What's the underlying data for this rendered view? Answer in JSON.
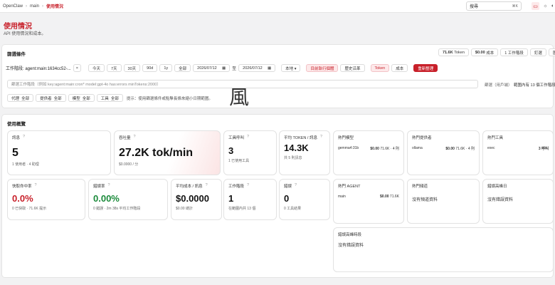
{
  "breadcrumb": {
    "root": "OpenClaw",
    "sep1": "›",
    "branch": "main",
    "sep2": "›",
    "current": "使用情況"
  },
  "search": {
    "value": "搜尋",
    "shortcut": "⌘K"
  },
  "page": {
    "title": "使用情況",
    "subtitle": "API 使用情況和成本。"
  },
  "filters": {
    "heading": "篩選條件",
    "tokens_value": "71.6K",
    "tokens_unit": "Token",
    "cost_value": "$0.00",
    "cost_unit": "成本",
    "sessions": "1 工作階段",
    "pin_label": "釘選",
    "export_label": "匯出 ▾",
    "session_label": "工作階段: agent:main:1634cc52-...",
    "clear": "×",
    "range_buttons": [
      "今天",
      "7天",
      "30天",
      "90d",
      "1y",
      "全部"
    ],
    "date_start": "2026/07/12",
    "to": "至",
    "date_end": "2026/07/12",
    "tz": "本地 ▾",
    "compare_current": "目前執行個體",
    "compare_history": "歷史沿革",
    "mode_token": "Token",
    "mode_cost": "成本",
    "refresh": "重新整理",
    "query_placeholder": "篩選工作階段（例如 key:agent:main:cron* model:gpt-4o has:errors minTokens:2000）",
    "query_hint": "篩選（用戶端）",
    "range_note": "範圍內有 13 個工作階段",
    "chips": [
      {
        "label": "代理",
        "value": "全部"
      },
      {
        "label": "提供者",
        "value": "全部"
      },
      {
        "label": "模型",
        "value": "全部"
      },
      {
        "label": "工具",
        "value": "全部"
      }
    ],
    "tip": "提示：使用篩選條件或點擊長條來縮小日期範圍。"
  },
  "overview": {
    "heading": "使用概覽",
    "cards": {
      "messages": {
        "label": "訊息",
        "value": "5",
        "sub": "1 使用者 · 4 助理"
      },
      "throughput": {
        "label": "吞吐量",
        "value": "27.2K tok/min",
        "sub": "$0.0000 / 分"
      },
      "tool_calls": {
        "label": "工具呼叫",
        "value": "3",
        "sub": "1 已使用工具"
      },
      "avg_tokens": {
        "label": "平均 TOKEN / 訊息",
        "value": "14.3K",
        "sub": "共 5 則訊息"
      },
      "cache_hit": {
        "label": "快取命中率",
        "value": "0.0%",
        "sub": "0 已快取 · 71.6K 提示"
      },
      "error_rate": {
        "label": "錯誤率",
        "value": "0.00%",
        "sub": "0 錯誤 · 2m 38s 平均工作階段"
      },
      "avg_cost": {
        "label": "平均成本 / 訊息",
        "value": "$0.0000",
        "sub": "$0.00 總計"
      },
      "sessions": {
        "label": "工作階段",
        "value": "1",
        "sub": "在範圍內共 13 個"
      },
      "errors": {
        "label": "錯誤",
        "value": "0",
        "sub": "0 工具結果"
      }
    },
    "top_models": {
      "title": "熱門模型",
      "name": "gemma4:31b",
      "cost": "$0.00",
      "detail": "71.6K · 4 則"
    },
    "top_providers": {
      "title": "熱門提供者",
      "name": "ollama",
      "cost": "$0.00",
      "detail": "71.6K · 4 則"
    },
    "top_tools": {
      "title": "熱門工具",
      "name": "exec",
      "detail": "3 呼叫"
    },
    "top_agents": {
      "title": "熱門 AGENT",
      "name": "main",
      "cost": "$0.00",
      "detail": "71.6K"
    },
    "top_channels": {
      "title": "熱門頻道",
      "empty": "沒有頻道資料"
    },
    "peak_error_days": {
      "title": "錯誤高峰日",
      "empty": "沒有錯誤資料"
    },
    "peak_error_hours": {
      "title": "錯誤高峰時段",
      "empty": "沒有錯誤資料"
    }
  },
  "watermark": "風"
}
